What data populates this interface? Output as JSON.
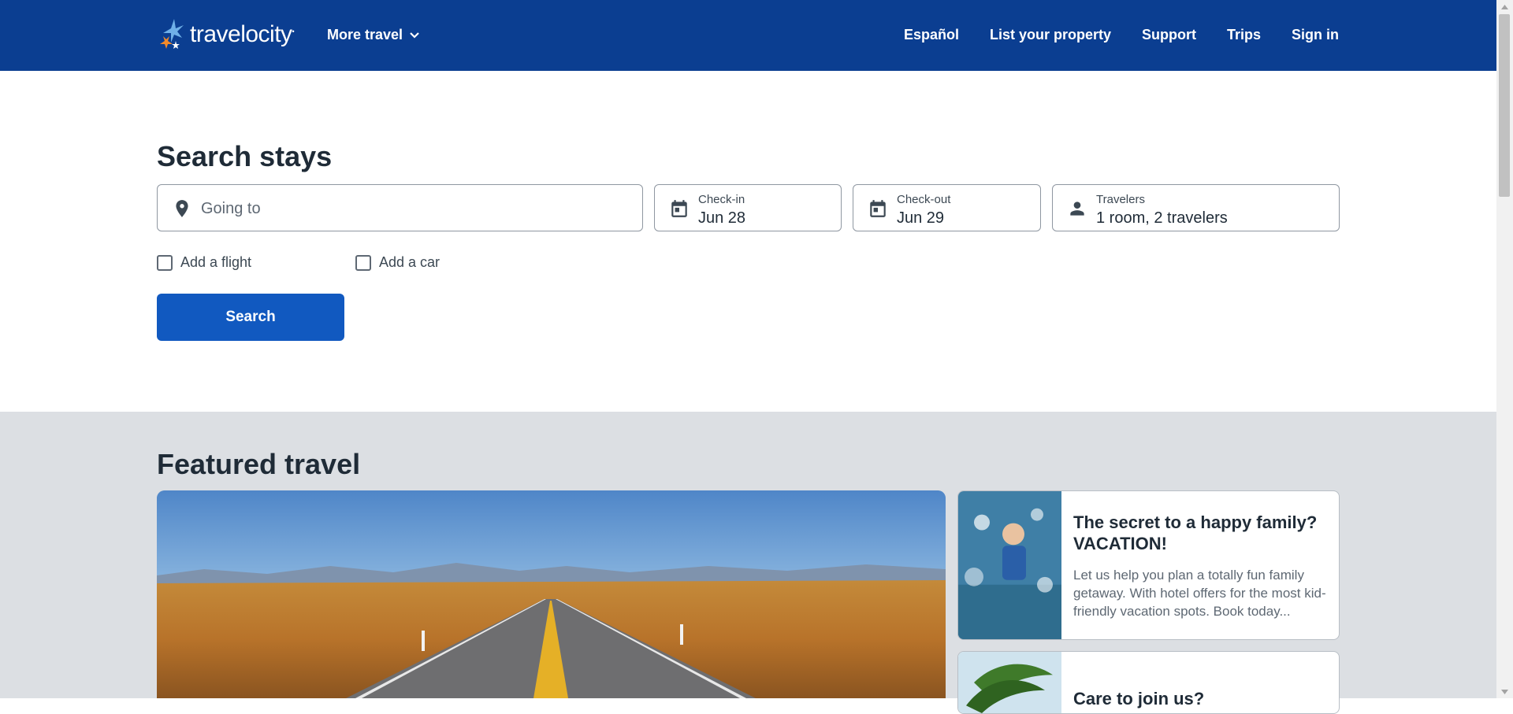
{
  "header": {
    "logo_text": "travelocity",
    "more_travel": "More travel",
    "nav": [
      "Español",
      "List your property",
      "Support",
      "Trips",
      "Sign in"
    ]
  },
  "search": {
    "title": "Search stays",
    "going_to_placeholder": "Going to",
    "checkin_label": "Check-in",
    "checkin_value": "Jun 28",
    "checkout_label": "Check-out",
    "checkout_value": "Jun 29",
    "travelers_label": "Travelers",
    "travelers_value": "1 room, 2 travelers",
    "add_flight": "Add a flight",
    "add_car": "Add a car",
    "button": "Search"
  },
  "featured": {
    "title": "Featured travel",
    "cards": [
      {
        "title": "The secret to a happy family? VACATION!",
        "description": "Let us help you plan a totally fun family getaway. With hotel offers for the most kid-friendly vacation spots. Book today..."
      },
      {
        "title": "Care to join us?",
        "description": ""
      }
    ]
  },
  "colors": {
    "header_bg": "#0b3e91",
    "button_bg": "#1159c0",
    "featured_bg": "#dcdfe3",
    "logo_accent": "#f28a2a",
    "logo_star": "#6fb0e8"
  }
}
